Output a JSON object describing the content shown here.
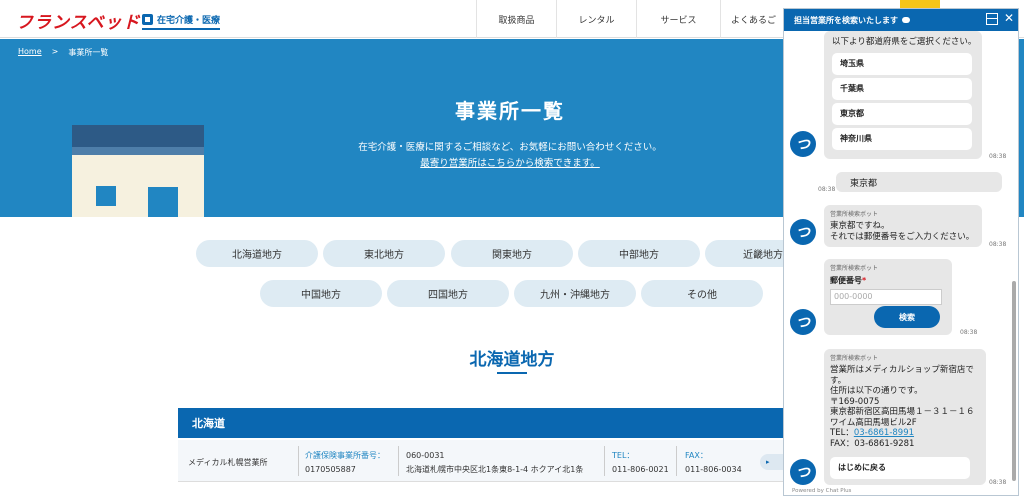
{
  "header": {
    "logo": "フランスベッド",
    "category": "在宅介護・医療",
    "nav": [
      "取扱商品",
      "レンタル",
      "サービス",
      "よくあるご"
    ]
  },
  "breadcrumb": {
    "home": "Home",
    "sep": ">",
    "current": "事業所一覧"
  },
  "hero": {
    "title": "事業所一覧",
    "text": "在宅介護・医療に関するご相談など、お気軽にお問い合わせください。",
    "link": "最寄り営業所はこちらから検索できます。"
  },
  "regions": {
    "row1": [
      "北海道地方",
      "東北地方",
      "関東地方",
      "中部地方",
      "近畿地方"
    ],
    "row2": [
      "中国地方",
      "四国地方",
      "九州・沖縄地方",
      "その他"
    ]
  },
  "section": {
    "title": "北海道地方"
  },
  "table": {
    "pref": "北海道",
    "rows": [
      {
        "name": "メディカル札幌営業所",
        "care_label": "介護保険事業所番号：",
        "care_no": "0170505887",
        "zip": "060-0031",
        "address": "北海道札幌市中央区北1条東8-1-4 ホクアイ北1条",
        "tel_label": "TEL：",
        "tel": "011-806-0021",
        "fax_label": "FAX：",
        "fax": "011-806-0034"
      }
    ]
  },
  "chat": {
    "header": "担当営業所を検索いたします",
    "intro": "以下より都道府県をご選択ください。",
    "choices": [
      "埼玉県",
      "千葉県",
      "東京都",
      "神奈川県"
    ],
    "times": [
      "08:38",
      "08:38",
      "08:38",
      "08:38",
      "08:38"
    ],
    "user_msg": "東京都",
    "bot_name": "営業所検索ボット",
    "reply1": [
      "東京都ですね。",
      "それでは郵便番号をご入力ください。"
    ],
    "zip_label": "郵便番号",
    "zip_required": "*",
    "zip_placeholder": "000-0000",
    "search_button": "検索",
    "result": [
      "営業所はメディカルショップ新宿店で",
      "す。",
      "住所は以下の通りです。",
      "〒169-0075",
      "東京都新宿区高田馬場１－３１－１６",
      "ワイム高田馬場ビル2F"
    ],
    "tel_label": "TEL：",
    "tel": "03-6861-8991",
    "fax_line": "FAX：03-6861-9281",
    "back_button": "はじめに戻る",
    "powered": "Powered by Chat Plus"
  },
  "colors": {
    "brand_blue": "#0a67b0",
    "hero_blue": "#2186c2",
    "logo_red": "#d7171f",
    "pill": "#deebf3"
  }
}
